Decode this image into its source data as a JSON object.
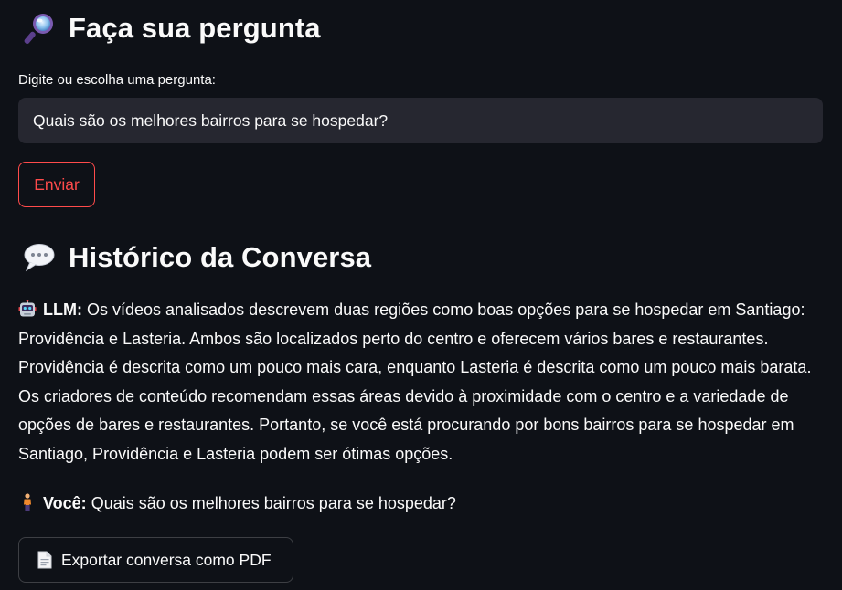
{
  "ask_section": {
    "title": "Faça sua pergunta",
    "title_icon": "magnifying-glass-icon",
    "input_label": "Digite ou escolha uma pergunta:",
    "input_value": "Quais são os melhores bairros para se hospedar?",
    "send_label": "Enviar"
  },
  "history_section": {
    "title": "Histórico da Conversa",
    "title_icon": "speech-bubble-icon",
    "messages": [
      {
        "icon": "robot-icon",
        "speaker": "LLM:",
        "text": "Os vídeos analisados descrevem duas regiões como boas opções para se hospedar em Santiago: Providência e Lasteria. Ambos são localizados perto do centro e oferecem vários bares e restaurantes. Providência é descrita como um pouco mais cara, enquanto Lasteria é descrita como um pouco mais barata. Os criadores de conteúdo recomendam essas áreas devido à proximidade com o centro e a variedade de opções de bares e restaurantes. Portanto, se você está procurando por bons bairros para se hospedar em Santiago, Providência e Lasteria podem ser ótimas opções."
      },
      {
        "icon": "person-icon",
        "speaker": "Você:",
        "text": "Quais são os melhores bairros para se hospedar?"
      }
    ],
    "export_label": "Exportar conversa como PDF",
    "export_icon": "document-icon"
  },
  "colors": {
    "background": "#0e1117",
    "input_background": "#262730",
    "accent": "#ff4b4b",
    "text": "#fafafa"
  }
}
